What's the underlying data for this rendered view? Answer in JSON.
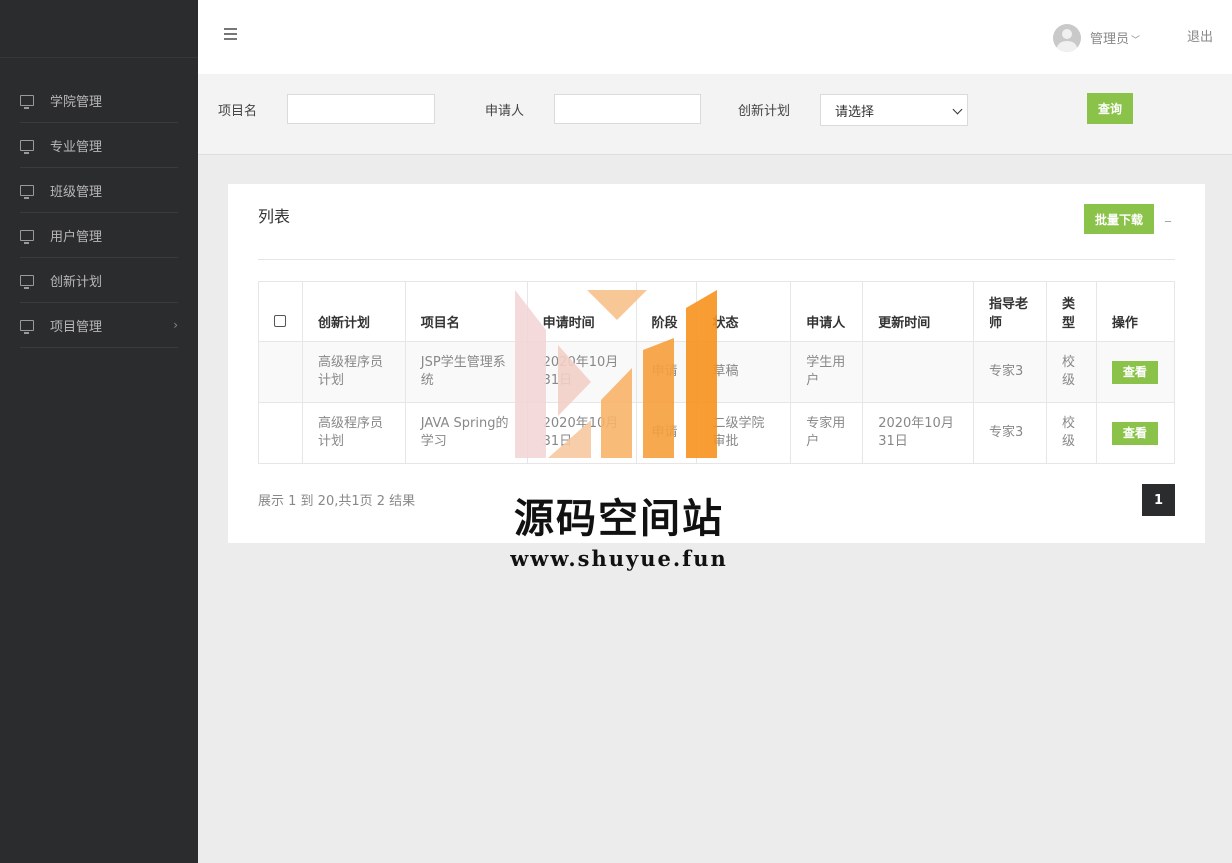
{
  "sidebar": {
    "items": [
      {
        "label": "学院管理",
        "icon": "monitor-icon"
      },
      {
        "label": "专业管理",
        "icon": "monitor-icon"
      },
      {
        "label": "班级管理",
        "icon": "monitor-icon"
      },
      {
        "label": "用户管理",
        "icon": "monitor-icon"
      },
      {
        "label": "创新计划",
        "icon": "monitor-icon"
      },
      {
        "label": "项目管理",
        "icon": "monitor-icon",
        "has_submenu": true
      }
    ],
    "submenu_indicator": "›"
  },
  "header": {
    "user_name": "管理员",
    "dropdown_caret": "﹀",
    "logout_label": "退出"
  },
  "search": {
    "project_name_label": "项目名",
    "project_name_value": "",
    "applicant_label": "申请人",
    "applicant_value": "",
    "plan_label": "创新计划",
    "plan_selected": "请选择",
    "query_label": "查询"
  },
  "panel": {
    "title": "列表",
    "batch_download_label": "批量下载",
    "collapse_label": "_"
  },
  "table": {
    "headers": [
      "创新计划",
      "项目名",
      "申请时间",
      "阶段",
      "状态",
      "申请人",
      "更新时间",
      "指导老师",
      "类型",
      "操作"
    ],
    "rows": [
      {
        "plan": "高级程序员计划",
        "project": "JSP学生管理系统",
        "apply_time": "2020年10月31日",
        "stage": "申请",
        "status": "草稿",
        "applicant": "学生用户",
        "update_time": "",
        "teacher": "专家3",
        "type": "校级",
        "action": "查看"
      },
      {
        "plan": "高级程序员计划",
        "project": "JAVA Spring的学习",
        "apply_time": "2020年10月31日",
        "stage": "申请",
        "status": "二级学院审批",
        "applicant": "专家用户",
        "update_time": "2020年10月31日",
        "teacher": "专家3",
        "type": "校级",
        "action": "查看"
      }
    ]
  },
  "pagination": {
    "info": "展示 1 到 20,共1页 2 结果",
    "current_page": "1"
  },
  "watermark": {
    "title": "源码空间站",
    "url": "www.shuyue.fun"
  },
  "colors": {
    "sidebar_bg": "#2b2c2e",
    "accent_green": "#8bc34a",
    "watermark_orange": "#f7931e"
  }
}
